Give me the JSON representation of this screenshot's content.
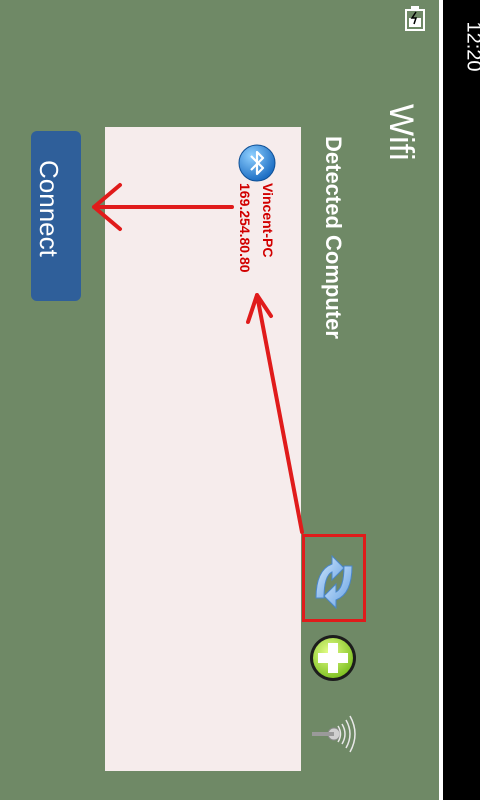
{
  "status_bar": {
    "time": "12:20",
    "icon": "battery-charging-icon"
  },
  "app": {
    "title": "Wifi",
    "section_title": "Detected Computer"
  },
  "device_list": {
    "items": [
      {
        "name": "Vincent-PC",
        "ip": "169.254.80.80",
        "icon": "bluetooth-icon"
      }
    ]
  },
  "buttons": {
    "connect_label": "Connect"
  },
  "toolbar": {
    "icons": [
      "refresh-icon",
      "add-icon",
      "signal-icon"
    ]
  },
  "colors": {
    "background": "#6f8966",
    "panel": "#f6ecec",
    "button": "#2f5f9a",
    "device_text": "#d10000",
    "annotation": "#e01b1b"
  }
}
